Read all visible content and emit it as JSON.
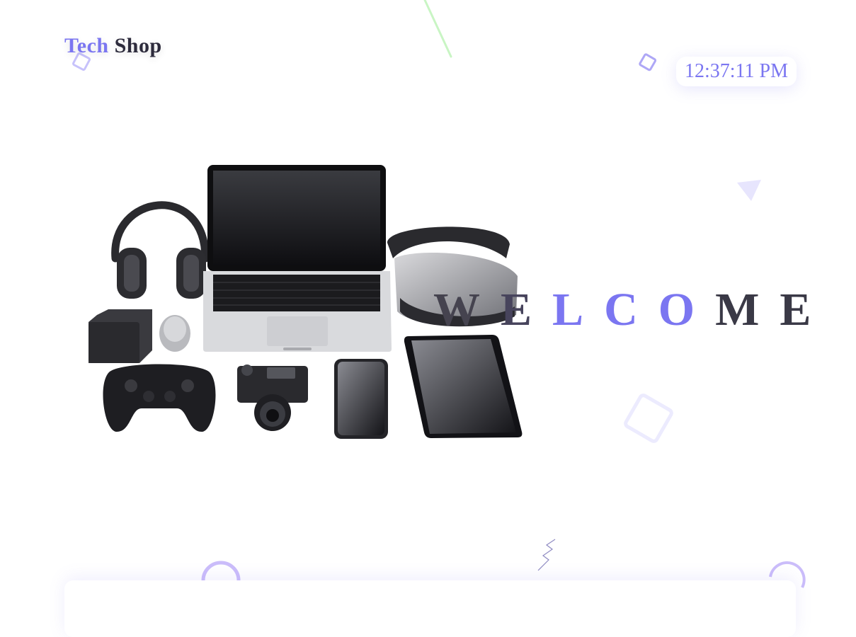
{
  "brand": {
    "part1": "Tech",
    "part2": "Shop"
  },
  "clock": {
    "time": "12:37:11 PM"
  },
  "welcome": {
    "letters": [
      {
        "char": "W",
        "color": "#45434f"
      },
      {
        "char": "E",
        "color": "#47445c"
      },
      {
        "char": "L",
        "color": "#7b76f1"
      },
      {
        "char": "C",
        "color": "#7b76f1"
      },
      {
        "char": "O",
        "color": "#7b76f1"
      },
      {
        "char": "M",
        "color": "#3a3946"
      },
      {
        "char": "E",
        "color": "#3a3946"
      }
    ]
  },
  "hero_image": {
    "items": [
      "headphones-icon",
      "laptop-icon",
      "vr-headset-icon",
      "hdd-icon",
      "mouse-icon",
      "gamepad-icon",
      "camera-icon",
      "smartphone-icon",
      "tablet-icon"
    ]
  },
  "colors": {
    "accent": "#7b76f1",
    "dark": "#2d2b3c"
  }
}
